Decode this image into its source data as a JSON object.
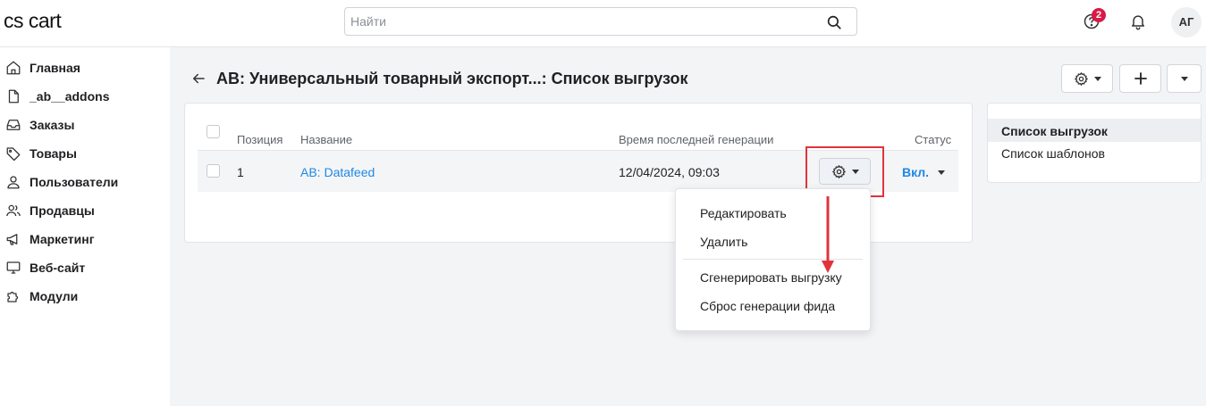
{
  "app": {
    "logo": "cs cart"
  },
  "header": {
    "search_placeholder": "Найти",
    "notifications_count": "2",
    "avatar_initials": "АГ"
  },
  "sidebar": {
    "items": [
      {
        "label": "Главная",
        "icon": "home-icon"
      },
      {
        "label": "_ab__addons",
        "icon": "file-icon"
      },
      {
        "label": "Заказы",
        "icon": "inbox-icon"
      },
      {
        "label": "Товары",
        "icon": "tag-icon"
      },
      {
        "label": "Пользователи",
        "icon": "user-icon"
      },
      {
        "label": "Продавцы",
        "icon": "users-icon"
      },
      {
        "label": "Маркетинг",
        "icon": "megaphone-icon"
      },
      {
        "label": "Веб-сайт",
        "icon": "monitor-icon"
      },
      {
        "label": "Модули",
        "icon": "puzzle-icon"
      }
    ]
  },
  "page": {
    "title": "AB: Универсальный товарный экспорт...: Список выгрузок"
  },
  "table": {
    "columns": [
      "Позиция",
      "Название",
      "Время последней генерации",
      "Статус"
    ],
    "rows": [
      {
        "position": "1",
        "name": "AB: Datafeed",
        "last_generated": "12/04/2024, 09:03",
        "status": "Вкл."
      }
    ]
  },
  "dropdown": {
    "items": [
      "Редактировать",
      "Удалить",
      "Сгенерировать выгрузку",
      "Сброс генерации фида"
    ]
  },
  "right_panel": {
    "items": [
      "Список выгрузок",
      "Список шаблонов"
    ],
    "active_index": 0
  },
  "colors": {
    "accent": "#1e88e5",
    "highlight": "#e0343c",
    "badge": "#d81b46"
  }
}
